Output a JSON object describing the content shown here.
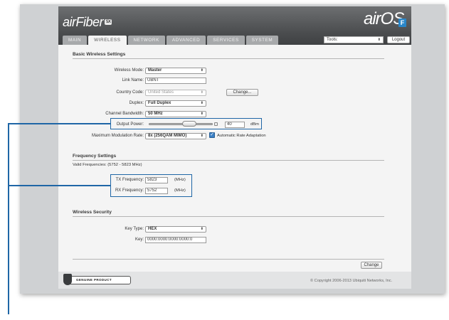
{
  "brand": {
    "name": "airFiber",
    "badge": "5X",
    "os": "airOS",
    "os_tile": "F"
  },
  "tabs": [
    {
      "label": "MAIN"
    },
    {
      "label": "WIRELESS"
    },
    {
      "label": "NETWORK"
    },
    {
      "label": "ADVANCED"
    },
    {
      "label": "SERVICES"
    },
    {
      "label": "SYSTEM"
    }
  ],
  "tools": {
    "value": "Tools:"
  },
  "logout_label": "Logout",
  "basic": {
    "title": "Basic Wireless Settings",
    "wireless_mode": {
      "label": "Wireless Mode:",
      "value": "Master"
    },
    "link_name": {
      "label": "Link Name:",
      "value": "UBNT"
    },
    "country_code": {
      "label": "Country Code:",
      "value": "United States",
      "button": "Change..."
    },
    "duplex": {
      "label": "Duplex:",
      "value": "Full Duplex"
    },
    "channel_bandwidth": {
      "label": "Channel Bandwidth:",
      "value": "50 MHz"
    },
    "output_power": {
      "label": "Output Power:",
      "value": "40",
      "unit": "dBm",
      "level": 0.6
    },
    "max_modulation": {
      "label": "Maximum Modulation Rate:",
      "value": "8x (256QAM MIMO)",
      "auto_label": "Automatic Rate Adaptation",
      "auto_checked": true
    }
  },
  "frequency": {
    "title": "Frequency Settings",
    "valid": "Valid Frequencies: (5752 - 5823 MHz)",
    "tx": {
      "label": "TX Frequency:",
      "value": "5823",
      "unit": "(MHz)"
    },
    "rx": {
      "label": "RX Frequency:",
      "value": "5752",
      "unit": "(MHz)"
    }
  },
  "security": {
    "title": "Wireless Security",
    "key_type": {
      "label": "Key Type:",
      "value": "HEX"
    },
    "key": {
      "label": "Key:",
      "value": "0000:0000:0000:0000:0"
    }
  },
  "change_label": "Change",
  "footer": {
    "genuine": "GENUINE PRODUCT",
    "copyright": "© Copyright 2006-2013 Ubiquiti Networks, Inc."
  },
  "colors": {
    "callout": "#1f66a6",
    "header": "#4a4c4e",
    "panel": "#f4f4f4"
  }
}
